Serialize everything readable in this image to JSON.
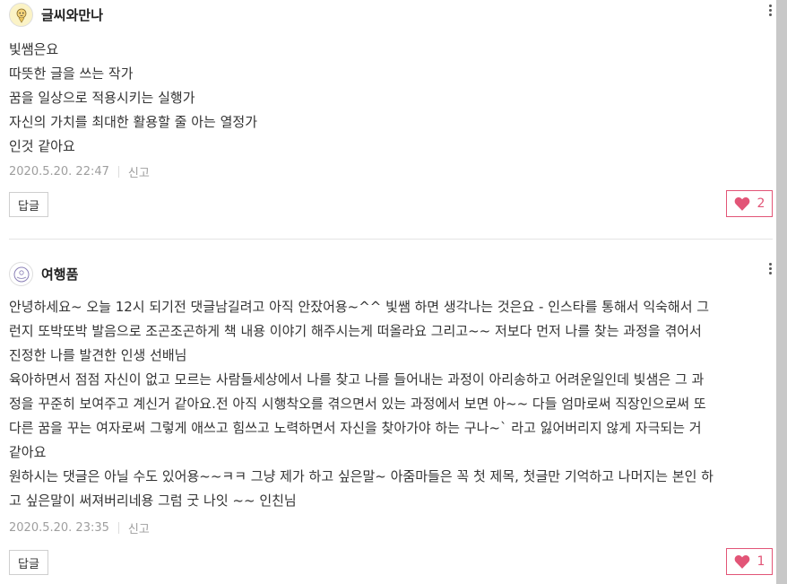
{
  "colors": {
    "like_accent": "#e25577",
    "meta_gray": "#9e9e9e"
  },
  "comments": [
    {
      "author": "글씨와만나",
      "avatar_icon": "yellow-character-avatar-icon",
      "lines": [
        "빛쌤은요",
        "따뜻한 글을 쓰는 작가",
        "꿈을 일상으로 적용시키는 실행가",
        "자신의 가치를 최대한 활용할 줄 아는 열정가",
        "인것 같아요"
      ],
      "timestamp": "2020.5.20. 22:47",
      "report_label": "신고",
      "reply_label": "답글",
      "likes": "2"
    },
    {
      "author": "여행품",
      "avatar_icon": "stamp-avatar-icon",
      "lines": [
        "안녕하세요~ 오늘 12시 되기전 댓글남길려고 아직 안잤어용~^^ 빛쌤 하면 생각나는 것은요 - 인스타를 통해서 익숙해서 그",
        "런지 또박또박 발음으로 조곤조곤하게 책 내용 이야기 해주시는게 떠올라요 그리고~~ 저보다 먼저 나를 찾는 과정을 겪어서",
        "진정한 나를 발견한 인생 선배님",
        "육아하면서 점점 자신이 없고 모르는 사람들세상에서 나를 찾고 나를 들어내는 과정이 아리송하고 어려운일인데 빛샘은 그 과",
        "정을 꾸준히 보여주고 계신거 같아요.전 아직 시행착오를 겪으면서 있는 과정에서 보면 아~~ 다들 엄마로써 직장인으로써 또",
        "다른 꿈을 꾸는 여자로써 그렇게 애쓰고 힘쓰고 노력하면서 자신을 찾아가야 하는 구나~` 라고 잃어버리지 않게 자극되는 거",
        "같아요",
        "원하시는 댓글은 아닐 수도 있어용~~ㅋㅋ 그냥 제가 하고 싶은말~ 아줌마들은 꼭 첫 제목, 첫글만 기억하고 나머지는 본인 하",
        "고 싶은말이 써져버리네용 그럼 굿 나잇 ~~ 인친님"
      ],
      "timestamp": "2020.5.20. 23:35",
      "report_label": "신고",
      "reply_label": "답글",
      "likes": "1"
    }
  ]
}
